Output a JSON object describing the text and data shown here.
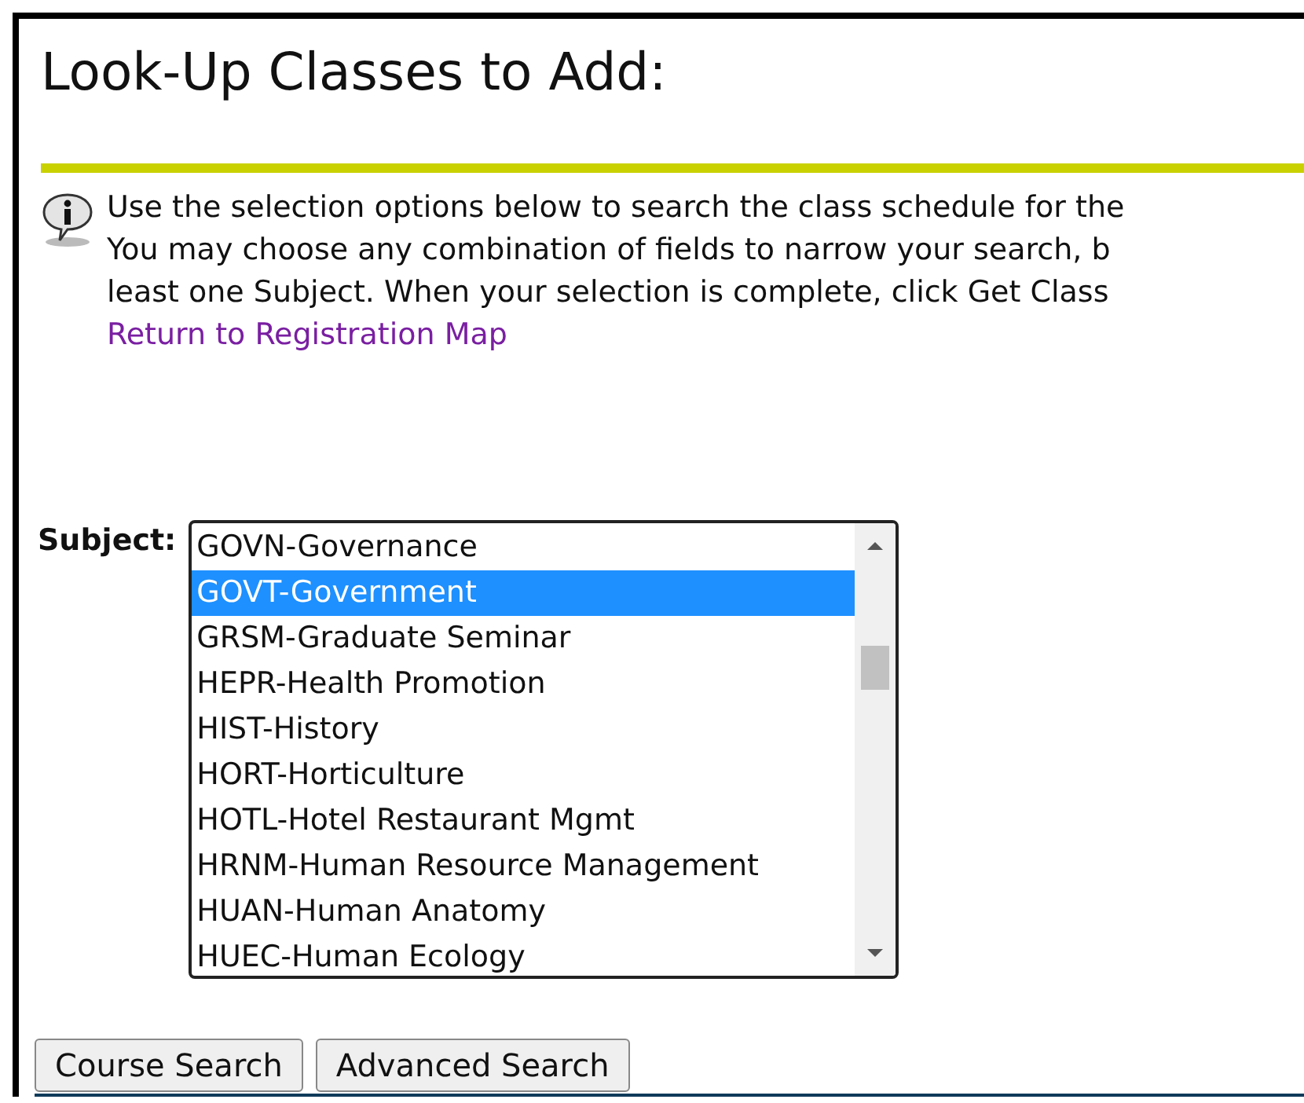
{
  "title": "Look-Up Classes to Add:",
  "info": {
    "lines": [
      "Use the selection options below to search the class schedule for the",
      "You may choose any combination of fields to narrow your search, b",
      "least one Subject. When your selection is complete, click Get Class"
    ],
    "link": "Return to Registration Map"
  },
  "subject": {
    "label": "Subject:",
    "options": [
      {
        "text": "GOVN-Governance",
        "selected": false
      },
      {
        "text": "GOVT-Government",
        "selected": true
      },
      {
        "text": "GRSM-Graduate Seminar",
        "selected": false
      },
      {
        "text": "HEPR-Health Promotion",
        "selected": false
      },
      {
        "text": "HIST-History",
        "selected": false
      },
      {
        "text": "HORT-Horticulture",
        "selected": false
      },
      {
        "text": "HOTL-Hotel Restaurant Mgmt",
        "selected": false
      },
      {
        "text": "HRNM-Human Resource Management",
        "selected": false
      },
      {
        "text": "HUAN-Human Anatomy",
        "selected": false
      },
      {
        "text": "HUEC-Human Ecology",
        "selected": false
      }
    ]
  },
  "buttons": [
    "Course Search",
    "Advanced Search"
  ]
}
